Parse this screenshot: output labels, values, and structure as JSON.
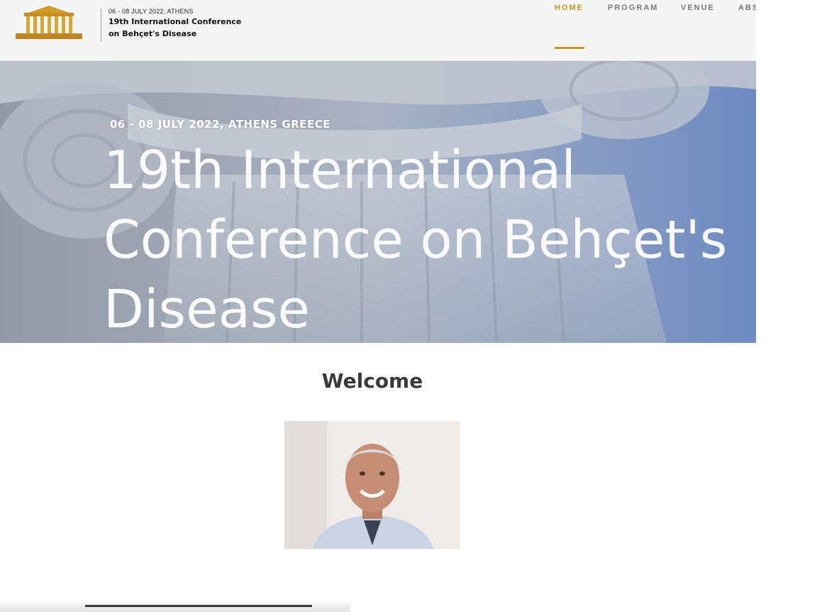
{
  "header": {
    "logo": {
      "date": "06 - 08 JULY 2022, ATHENS",
      "title_line1": "19th International Conference",
      "title_line2": "on Behçet's Disease"
    },
    "nav": [
      {
        "label": "HOME",
        "active": true
      },
      {
        "label": "PROGRAM",
        "active": false
      },
      {
        "label": "VENUE",
        "active": false
      },
      {
        "label": "ABS",
        "active": false
      }
    ],
    "accent_color": "#c6961d"
  },
  "hero": {
    "date": "06 - 08 JULY 2022, ATHENS GREECE",
    "title_lines": [
      "19th International",
      "Conference on Behçet's",
      "Disease"
    ]
  },
  "welcome": {
    "heading": "Welcome"
  }
}
